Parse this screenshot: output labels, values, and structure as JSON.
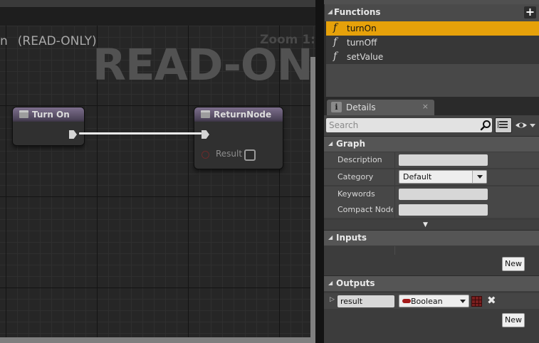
{
  "graph": {
    "title_prefix": "n",
    "title_readonly": "(READ-ONLY)",
    "zoom_label": "Zoom 1:",
    "watermark": "READ-ONLY",
    "nodes": {
      "turn_on": {
        "title": "Turn On"
      },
      "return_node": {
        "title": "ReturnNode",
        "result_label": "Result"
      }
    }
  },
  "functions": {
    "header": "Functions",
    "add_symbol": "+",
    "icon_glyph": "f",
    "items": [
      {
        "name": "turnOn",
        "selected": true
      },
      {
        "name": "turnOff",
        "selected": false
      },
      {
        "name": "setValue",
        "selected": false
      }
    ]
  },
  "details_tab": {
    "label": "Details",
    "icon_glyph": "i",
    "close_symbol": "×"
  },
  "details": {
    "search_placeholder": "Search",
    "graph_section": {
      "title": "Graph",
      "description_label": "Description",
      "category_label": "Category",
      "category_value": "Default",
      "keywords_label": "Keywords",
      "compact_label": "Compact Node T"
    },
    "inputs_section": {
      "title": "Inputs",
      "new_label": "New"
    },
    "outputs_section": {
      "title": "Outputs",
      "output_name": "result",
      "output_type": "Boolean",
      "remove_symbol": "✖",
      "new_label": "New"
    }
  },
  "colors": {
    "selection": "#e6a10a",
    "node_header": "#5c5168",
    "boolean_pin": "#a31a1a"
  }
}
